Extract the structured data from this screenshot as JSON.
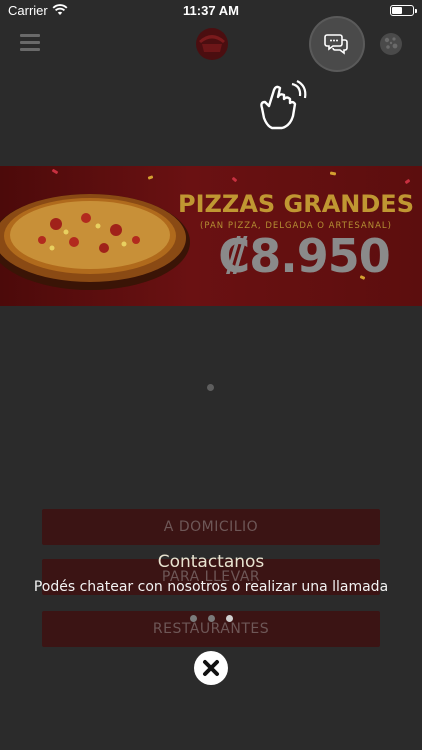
{
  "status_bar": {
    "carrier": "Carrier",
    "time": "11:37 AM",
    "battery_level": 0.5
  },
  "header": {
    "menu_icon": "hamburger-menu-icon",
    "logo": "pizza-hut-logo",
    "chat_icon": "chat-bubbles-icon",
    "cookie_icon": "pizza-cookie-icon",
    "gesture_icon": "tap-hand-icon"
  },
  "banner": {
    "title": "PIZZAS GRANDES",
    "subtitle": "(PAN PIZZA, DELGADA O ARTESANAL)",
    "price": "₡8.950"
  },
  "actions": {
    "delivery": "A DOMICILIO",
    "takeaway": "PARA LLEVAR",
    "restaurants": "RESTAURANTES"
  },
  "tooltip": {
    "title": "Contactanos",
    "text": "Podés chatear con nosotros o realizar una llamada",
    "pages": 3,
    "active_page": 3
  },
  "colors": {
    "brand_red": "#3b1414",
    "banner_gold": "#c09732",
    "overlay_bg": "#2b2b2b"
  }
}
